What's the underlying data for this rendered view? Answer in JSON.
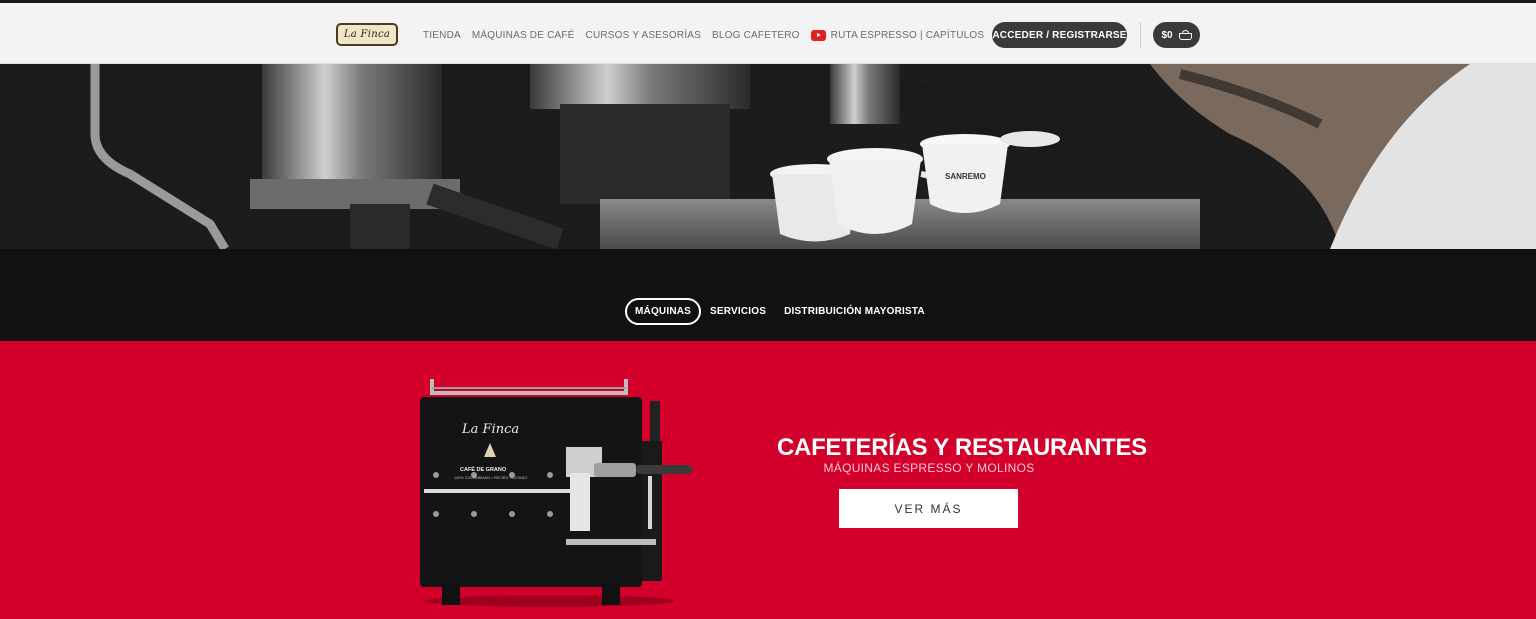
{
  "header": {
    "logo_text": "La Finca",
    "nav": [
      "TIENDA",
      "MÁQUINAS DE CAFÉ",
      "CURSOS Y ASESORÍAS",
      "BLOG CAFETERO",
      "RUTA ESPRESSO | CAPÍTULOS"
    ],
    "login_label": "ACCEDER / REGISTRARSE",
    "cart_total": "$0"
  },
  "tabs": [
    {
      "label": "MÁQUINAS",
      "active": true
    },
    {
      "label": "SERVICIOS",
      "active": false
    },
    {
      "label": "DISTRIBUICIÓN MAYORISTA",
      "active": false
    }
  ],
  "promo": {
    "title": "CAFETERÍAS Y RESTAURANTES",
    "subtitle": "MÁQUINAS ESPRESSO Y MOLINOS",
    "button_label": "VER MÁS",
    "machine_brand": "La Finca",
    "machine_label": "CAFÉ DE GRANO",
    "machine_tagline": "100% COLOMBIANO • RECIÉN TOSTADO",
    "hero_cup_brand": "SANREMO"
  },
  "colors": {
    "promo_background": "#d2002a",
    "tabs_background": "#111111",
    "header_background": "#f3f3f3",
    "pill_button": "#3a3a3a",
    "youtube_red": "#e02020"
  },
  "icons": [
    "youtube-icon",
    "cart-icon"
  ]
}
